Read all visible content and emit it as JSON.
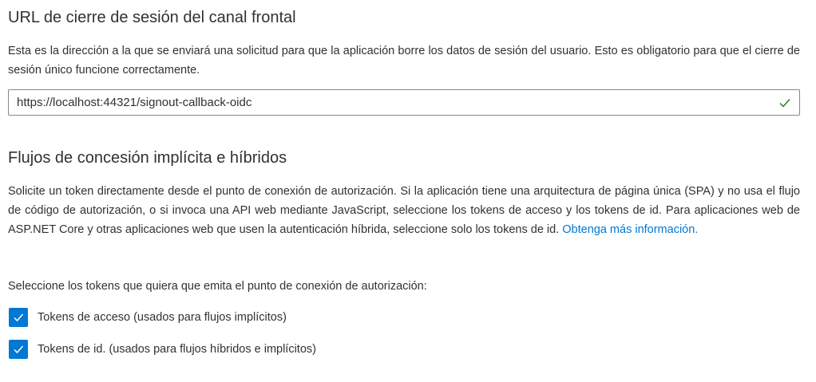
{
  "logout_section": {
    "title": "URL de cierre de sesión del canal frontal",
    "description": "Esta es la dirección a la que se enviará una solicitud para que la aplicación borre los datos de sesión del usuario. Esto es obligatorio para que el cierre de sesión único funcione correctamente.",
    "url_value": "https://localhost:44321/signout-callback-oidc",
    "valid_icon": "checkmark-icon",
    "valid_color": "#107c10"
  },
  "implicit_section": {
    "title": "Flujos de concesión implícita e híbridos",
    "description": "Solicite un token directamente desde el punto de conexión de autorización. Si la aplicación tiene una arquitectura de página única (SPA) y no usa el flujo de código de autorización, o si invoca una API web mediante JavaScript, seleccione los tokens de acceso y los tokens de id. Para aplicaciones web de ASP.NET Core y otras aplicaciones web que usen la autenticación híbrida, seleccione solo los tokens de id.",
    "learn_more_link": "Obtenga más información.",
    "select_label": "Seleccione los tokens que quiera que emita el punto de conexión de autorización:",
    "checkboxes": [
      {
        "label": "Tokens de acceso (usados para flujos implícitos)",
        "checked": true
      },
      {
        "label": "Tokens de id. (usados para flujos híbridos e implícitos)",
        "checked": true
      }
    ]
  },
  "colors": {
    "accent": "#0078d4",
    "text": "#323130",
    "border": "#8a8886"
  }
}
